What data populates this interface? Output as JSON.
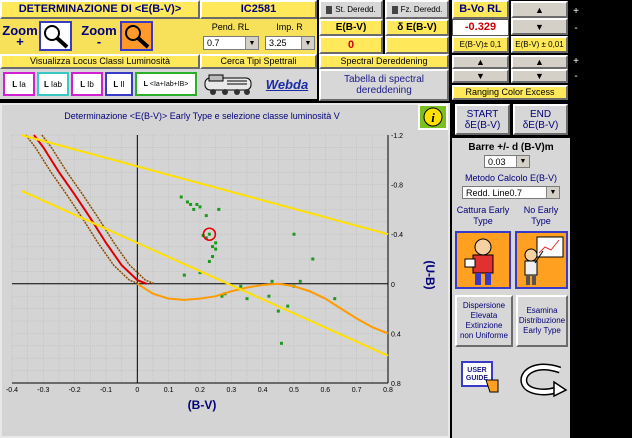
{
  "header": {
    "title": "DETERMINAZIONE DI <E(B-V)>",
    "object": "IC2581",
    "zoom_plus": "Zoom",
    "zoom_plus_sign": "+",
    "zoom_minus": "Zoom",
    "zoom_minus_sign": "-",
    "st_dereddened": "St. Deredd.",
    "fz_dereddened": "Fz. Deredd.",
    "pend_label": "Pend. RL",
    "pend_value": "0.7",
    "imp_label": "Imp. R",
    "imp_value": "3.25",
    "ebv_label": "E(B-V)",
    "ebv_value": "0",
    "debv_label": "δ E(B-V)",
    "debv_value": "",
    "bvo_label": "B-Vo RL",
    "bvo_value": "-0.329",
    "ebv_step1": "E(B-V)± 0,1",
    "ebv_step2": "E(B-V) ± 0,01",
    "plus_sign": "+",
    "minus_sign": "-"
  },
  "row2": {
    "locus_label": "Visualizza Locus Classi Luminosità",
    "spectral_search": "Cerca Tipi Spettrali",
    "spectral_dereddening": "Spectral Dereddening",
    "webda": "Webda",
    "table_btn": "Tabella di spectral dereddening",
    "ranging": "Ranging Color Excess",
    "classes": [
      "Ia",
      "Iab",
      "Ib",
      "II",
      "<Ia+Iab+IB>"
    ]
  },
  "chart": {
    "title": "Determinazione <E(B-V)> Early Type e selezione classe luminosità V",
    "xlabel": "(B-V)",
    "ylabel": "(U-B)",
    "x_ticks": [
      "-0.4",
      "-0.3",
      "-0.2",
      "-0.1",
      "0",
      "0.1",
      "0.2",
      "0.3",
      "0.4",
      "0.5",
      "0.6",
      "0.7",
      "0.8"
    ],
    "y_ticks": [
      "-1.2",
      "-0.8",
      "-0.4",
      "0",
      "0.4",
      "0.8"
    ]
  },
  "chart_data": {
    "type": "scatter",
    "title": "Determinazione <E(B-V)> Early Type e selezione classe luminosità V",
    "xlabel": "(B-V)",
    "ylabel": "(U-B)",
    "xlim": [
      -0.4,
      0.8
    ],
    "ylim": [
      -1.2,
      0.8
    ],
    "y_inverted": true,
    "grid": true,
    "series": [
      {
        "name": "",
        "kind": "points",
        "color": "#1a9a1a",
        "x": [
          0.14,
          0.16,
          0.17,
          0.18,
          0.19,
          0.2,
          0.21,
          0.22,
          0.23,
          0.24,
          0.25,
          0.24,
          0.25,
          0.23,
          0.22,
          0.26,
          0.2,
          0.15,
          0.28,
          0.35,
          0.42,
          0.45,
          0.48,
          0.5,
          0.43,
          0.33,
          0.27,
          0.52,
          0.5,
          0.56,
          0.63,
          0.46
        ],
        "y": [
          -0.7,
          -0.66,
          -0.64,
          -0.6,
          -0.64,
          -0.62,
          -0.39,
          -0.37,
          -0.4,
          -0.3,
          -0.28,
          -0.22,
          -0.33,
          -0.18,
          -0.55,
          -0.6,
          -0.09,
          -0.07,
          0.08,
          0.12,
          0.1,
          0.22,
          0.18,
          0.02,
          -0.02,
          0.02,
          0.1,
          -0.02,
          -0.4,
          -0.2,
          0.12,
          0.48
        ],
        "values_estimated": true
      },
      {
        "name": "",
        "kind": "line",
        "color": "#e00000",
        "x": [
          -0.33,
          -0.3,
          -0.25,
          -0.2,
          -0.15,
          -0.1,
          -0.05,
          0.0,
          0.03
        ],
        "y": [
          -1.2,
          -1.1,
          -0.9,
          -0.72,
          -0.53,
          -0.33,
          -0.15,
          -0.03,
          0.0
        ]
      },
      {
        "name": "",
        "kind": "line",
        "color": "#ff9a00",
        "x": [
          0.0,
          0.05,
          0.1,
          0.15,
          0.2,
          0.25,
          0.3,
          0.35,
          0.4,
          0.45,
          0.5,
          0.55,
          0.6,
          0.65,
          0.7,
          0.75,
          0.8
        ],
        "y": [
          0.0,
          0.08,
          0.12,
          0.13,
          0.12,
          0.1,
          0.06,
          0.03,
          0.01,
          0.0,
          0.02,
          0.06,
          0.12,
          0.2,
          0.28,
          0.35,
          0.4
        ]
      },
      {
        "name": "",
        "kind": "line",
        "color": "#ffe000",
        "x": [
          -0.37,
          0.8
        ],
        "y": [
          -1.2,
          -0.4
        ]
      },
      {
        "name": "",
        "kind": "line",
        "color": "#ffe000",
        "x": [
          -0.37,
          0.8
        ],
        "y": [
          -0.75,
          0.58
        ]
      }
    ],
    "highlight": {
      "x": 0.23,
      "y": -0.4,
      "color": "#e00000"
    }
  },
  "right_panel": {
    "start_label": "START",
    "start_sub": "δE(B-V)",
    "end_label": "END",
    "end_sub": "δE(B-V)",
    "bars_label": "Barre +/- d (B-V)m",
    "bars_value": "0.03",
    "method_label": "Metodo Calcolo E(B-V)",
    "method_value": "Redd. Line0.7",
    "capture_label": "Cattura Early Type",
    "no_early_label": "No Early Type",
    "dispersion_btn": "Dispersione Elevata Extinzione non Uniforme",
    "examine_btn": "Esamina Distribuzione Early Type",
    "user_guide": "USER GUIDE"
  },
  "colors": {
    "yellow": "#ffe95a",
    "panel_gray": "#d7d7d7",
    "title_navy": "#00007a"
  }
}
